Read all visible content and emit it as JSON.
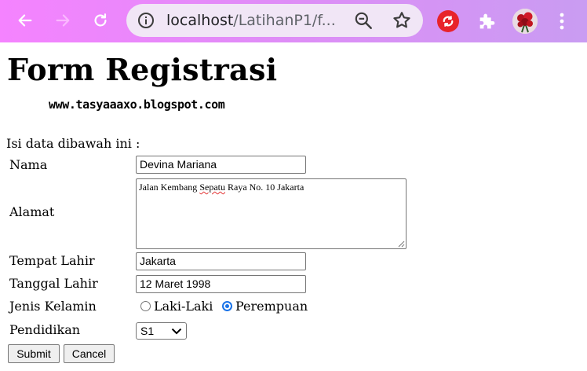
{
  "browser": {
    "url_host": "localhost",
    "url_path": "/LatihanP1/f..."
  },
  "page": {
    "title": "Form Registrasi",
    "blog": "www.tasyaaaxo.blogspot.com",
    "intro": "Isi data dibawah ini :"
  },
  "form": {
    "nama": {
      "label": "Nama",
      "value": "Devina Mariana"
    },
    "alamat": {
      "label": "Alamat",
      "value_prefix": "Jalan Kembang ",
      "value_spell": "Sepatu",
      "value_suffix": " Raya No. 10 Jakarta"
    },
    "tempat_lahir": {
      "label": "Tempat Lahir",
      "value": "Jakarta"
    },
    "tanggal_lahir": {
      "label": "Tanggal Lahir",
      "value": "12 Maret 1998"
    },
    "jenis_kelamin": {
      "label": "Jenis Kelamin",
      "options": [
        "Laki-Laki",
        "Perempuan"
      ],
      "selected": "Perempuan"
    },
    "pendidikan": {
      "label": "Pendidikan",
      "selected": "S1"
    },
    "submit_label": "Submit",
    "cancel_label": "Cancel"
  },
  "icons": {
    "back": "arrow-left-icon",
    "forward": "arrow-right-icon",
    "reload": "reload-icon",
    "info": "info-icon",
    "zoom": "zoom-out-icon",
    "star": "star-icon",
    "extension": "sync-extension-icon",
    "puzzle": "puzzle-icon",
    "menu": "kebab-menu-icon"
  },
  "colors": {
    "toolbar_gradient_start": "#f583ff",
    "toolbar_gradient_end": "#c99cf2",
    "radio_accent": "#1a73e8",
    "extension_red": "#e8232b"
  }
}
